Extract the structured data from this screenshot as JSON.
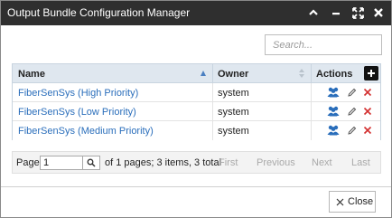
{
  "window": {
    "title": "Output Bundle Configuration Manager",
    "controls": [
      "chevron-up-icon",
      "minimize-icon",
      "maximize-icon",
      "close-icon"
    ]
  },
  "search": {
    "placeholder": "Search...",
    "value": ""
  },
  "grid": {
    "columns": [
      {
        "label": "Name",
        "sort": "ascending"
      },
      {
        "label": "Owner",
        "sort": "none"
      },
      {
        "label": "Actions"
      }
    ],
    "rows": [
      {
        "name": "FiberSenSys (High Priority)",
        "owner": "system"
      },
      {
        "name": "FiberSenSys (Low Priority)",
        "owner": "system"
      },
      {
        "name": "FiberSenSys (Medium Priority)",
        "owner": "system"
      }
    ],
    "row_actions": [
      "users-icon",
      "pencil-icon",
      "delete-x-icon"
    ],
    "add_icon": "plus-icon"
  },
  "pager": {
    "page_label": "Page",
    "page_value": "1",
    "info": "of 1 pages; 3 items, 3 total",
    "first": "First",
    "previous": "Previous",
    "next": "Next",
    "last": "Last"
  },
  "footer": {
    "close_label": "Close"
  },
  "colors": {
    "titlebar": "#2f2f2f",
    "header": "#dfe7ef",
    "link": "#2a6ebb",
    "users_icon": "#2a6ebb",
    "delete": "#d32f2f"
  }
}
